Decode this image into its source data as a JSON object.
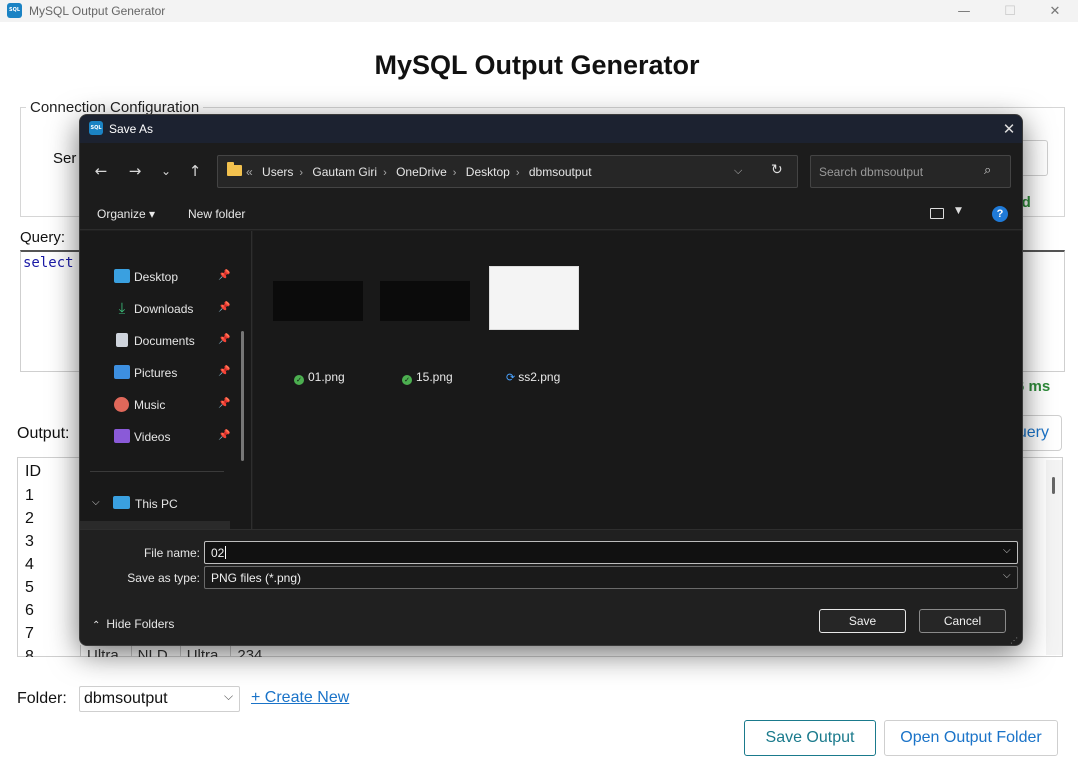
{
  "window": {
    "title": "MySQL Output Generator",
    "app_icon": "SQL",
    "controls": {
      "minimize": "—",
      "maximize": "☐",
      "close": "✕"
    }
  },
  "app": {
    "heading": "MySQL Output Generator",
    "connection_legend": "Connection Configuration",
    "server_label": "Ser",
    "status_text": "cted",
    "query_label": "Query:",
    "query_text": "select",
    "exec_time": "6 ms",
    "output_label": "Output:",
    "run_button": "uery",
    "output": {
      "header": "ID",
      "rows": [
        "1",
        "2",
        "3",
        "4",
        "5",
        "6",
        "7",
        "8"
      ],
      "partial_cells": [
        "Ultra",
        "NLD",
        "Ultra",
        "234"
      ]
    },
    "folder_label": "Folder:",
    "folder_value": "dbmsoutput",
    "create_new": "+ Create New",
    "save_output": "Save Output",
    "open_folder": "Open Output Folder"
  },
  "dialog": {
    "title": "Save As",
    "icon": "SQL",
    "close": "✕",
    "nav": {
      "back": "←",
      "forward": "→",
      "recent": "⌄",
      "up": "↑"
    },
    "breadcrumbs": [
      "Users",
      "Gautam Giri",
      "OneDrive",
      "Desktop",
      "dbmsoutput"
    ],
    "crumb_prefix": "«",
    "search_placeholder": "Search dbmsoutput",
    "organize": "Organize ▾",
    "new_folder": "New folder",
    "help": "?",
    "quick_access": [
      {
        "label": "Desktop",
        "icon": "desktop-icon",
        "color": "#3aa0e0"
      },
      {
        "label": "Downloads",
        "icon": "download-icon",
        "color": "#3bbf7a"
      },
      {
        "label": "Documents",
        "icon": "documents-icon",
        "color": "#cfd4dc"
      },
      {
        "label": "Pictures",
        "icon": "pictures-icon",
        "color": "#3d8fe0"
      },
      {
        "label": "Music",
        "icon": "music-icon",
        "color": "#e0685a"
      },
      {
        "label": "Videos",
        "icon": "videos-icon",
        "color": "#8a5ad8"
      }
    ],
    "this_pc": "This PC",
    "files": [
      {
        "name": "01.png",
        "status": "synced"
      },
      {
        "name": "15.png",
        "status": "synced"
      },
      {
        "name": "ss2.png",
        "status": "syncing"
      }
    ],
    "file_name_label": "File name:",
    "file_name_value": "02",
    "save_type_label": "Save as type:",
    "save_type_value": "PNG files (*.png)",
    "hide_folders": "Hide Folders",
    "save": "Save",
    "cancel": "Cancel"
  }
}
